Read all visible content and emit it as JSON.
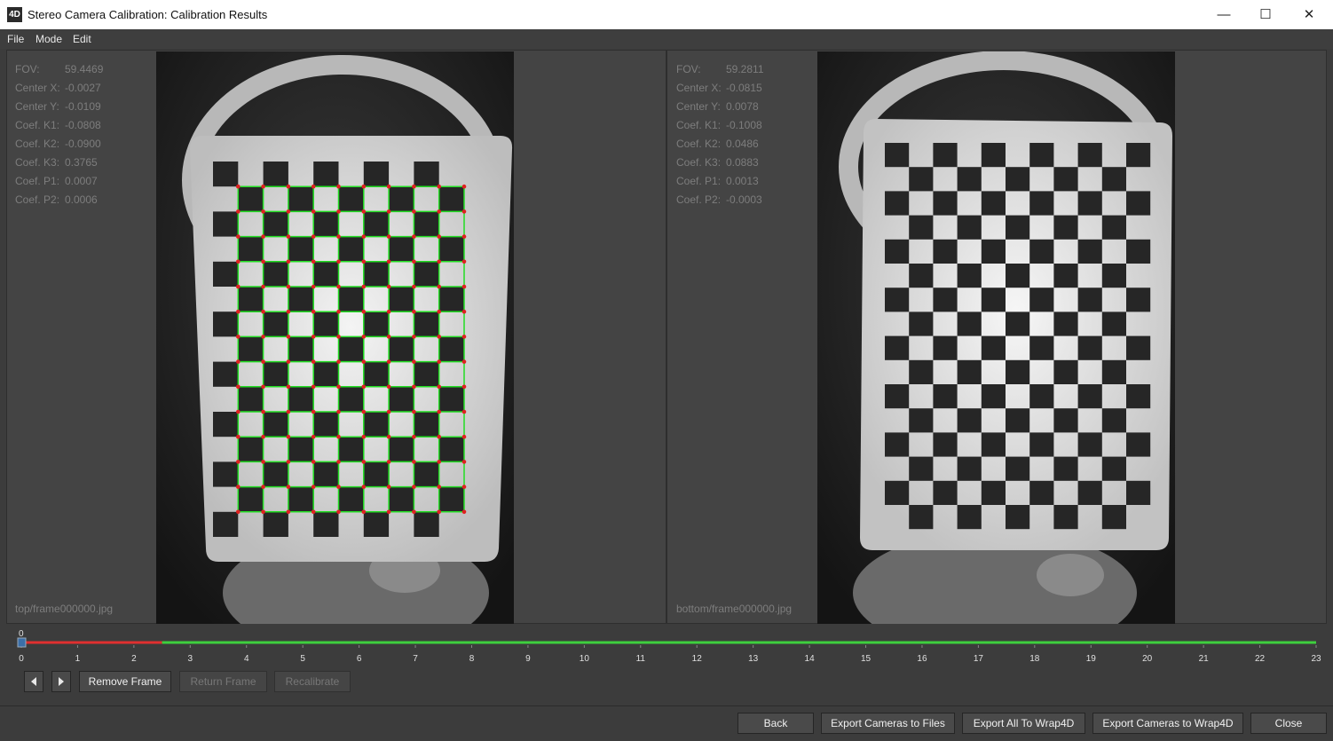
{
  "window": {
    "app_icon": "4D",
    "title": "Stereo Camera Calibration: Calibration Results",
    "minimize_glyph": "—",
    "maximize_glyph": "☐",
    "close_glyph": "✕"
  },
  "menu": [
    "File",
    "Mode",
    "Edit"
  ],
  "left_view": {
    "params": [
      {
        "label": "FOV:",
        "value": "59.4469"
      },
      {
        "label": "Center X:",
        "value": "-0.0027"
      },
      {
        "label": "Center Y:",
        "value": "-0.0109"
      },
      {
        "label": "Coef. K1:",
        "value": "-0.0808"
      },
      {
        "label": "Coef. K2:",
        "value": "-0.0900"
      },
      {
        "label": "Coef. K3:",
        "value": "0.3765"
      },
      {
        "label": "Coef. P1:",
        "value": "0.0007"
      },
      {
        "label": "Coef. P2:",
        "value": "0.0006"
      }
    ],
    "filename": "top/frame000000.jpg"
  },
  "right_view": {
    "params": [
      {
        "label": "FOV:",
        "value": "59.2811"
      },
      {
        "label": "Center X:",
        "value": "-0.0815"
      },
      {
        "label": "Center Y:",
        "value": "0.0078"
      },
      {
        "label": "Coef. K1:",
        "value": "-0.1008"
      },
      {
        "label": "Coef. K2:",
        "value": "0.0486"
      },
      {
        "label": "Coef. K3:",
        "value": "0.0883"
      },
      {
        "label": "Coef. P1:",
        "value": "0.0013"
      },
      {
        "label": "Coef. P2:",
        "value": "-0.0003"
      }
    ],
    "filename": "bottom/frame000000.jpg"
  },
  "timeline": {
    "current_frame": "0",
    "ticks": [
      "0",
      "1",
      "2",
      "3",
      "4",
      "5",
      "6",
      "7",
      "8",
      "9",
      "10",
      "11",
      "12",
      "13",
      "14",
      "15",
      "16",
      "17",
      "18",
      "19",
      "20",
      "21",
      "22",
      "23"
    ],
    "max": 23,
    "red_until": 2.5,
    "colors": {
      "removed": "#e03030",
      "active": "#3ecf3e"
    }
  },
  "frame_controls": {
    "prev_icon": "prev-arrow-icon",
    "next_icon": "next-arrow-icon",
    "remove_frame": "Remove Frame",
    "return_frame": "Return Frame",
    "recalibrate": "Recalibrate"
  },
  "footer": {
    "back": "Back",
    "export_files": "Export Cameras to Files",
    "export_all": "Export All To Wrap4D",
    "export_wrap": "Export Cameras to Wrap4D",
    "close": "Close"
  }
}
